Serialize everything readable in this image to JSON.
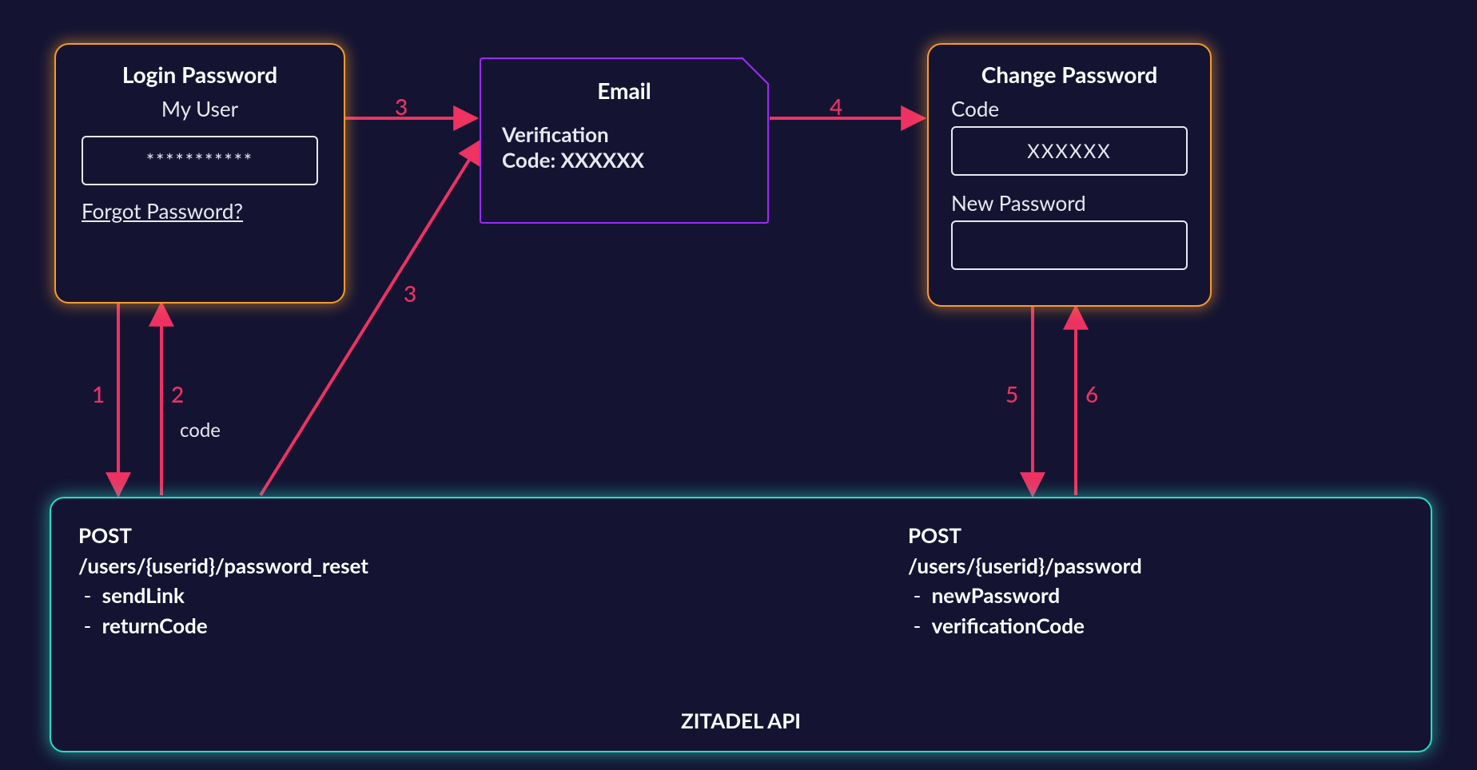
{
  "login_box": {
    "title": "Login Password",
    "user": "My User",
    "password_mask": "***********",
    "forgot_link": "Forgot Password?"
  },
  "email_box": {
    "title": "Email",
    "line1": "Verification",
    "line2": "Code: XXXXXX"
  },
  "change_box": {
    "title": "Change Password",
    "code_label": "Code",
    "code_value": "XXXXXX",
    "newpw_label": "New Password",
    "newpw_value": ""
  },
  "api_box": {
    "footer_title": "ZITADEL API",
    "left": {
      "method": "POST",
      "path": "/users/{userid}/password_reset",
      "params": [
        "sendLink",
        "returnCode"
      ]
    },
    "right": {
      "method": "POST",
      "path": "/users/{userid}/password",
      "params": [
        "newPassword",
        "verificationCode"
      ]
    }
  },
  "arrows": {
    "a1": "1",
    "a2": "2",
    "a2_sub": "code",
    "a3a": "3",
    "a3b": "3",
    "a4": "4",
    "a5": "5",
    "a6": "6"
  },
  "colors": {
    "bg": "#141432",
    "orange": "#f79b2b",
    "purple": "#9b2bf7",
    "cyan": "#29dcc6",
    "arrow": "#ee3262",
    "text": "#e8e8f0"
  }
}
